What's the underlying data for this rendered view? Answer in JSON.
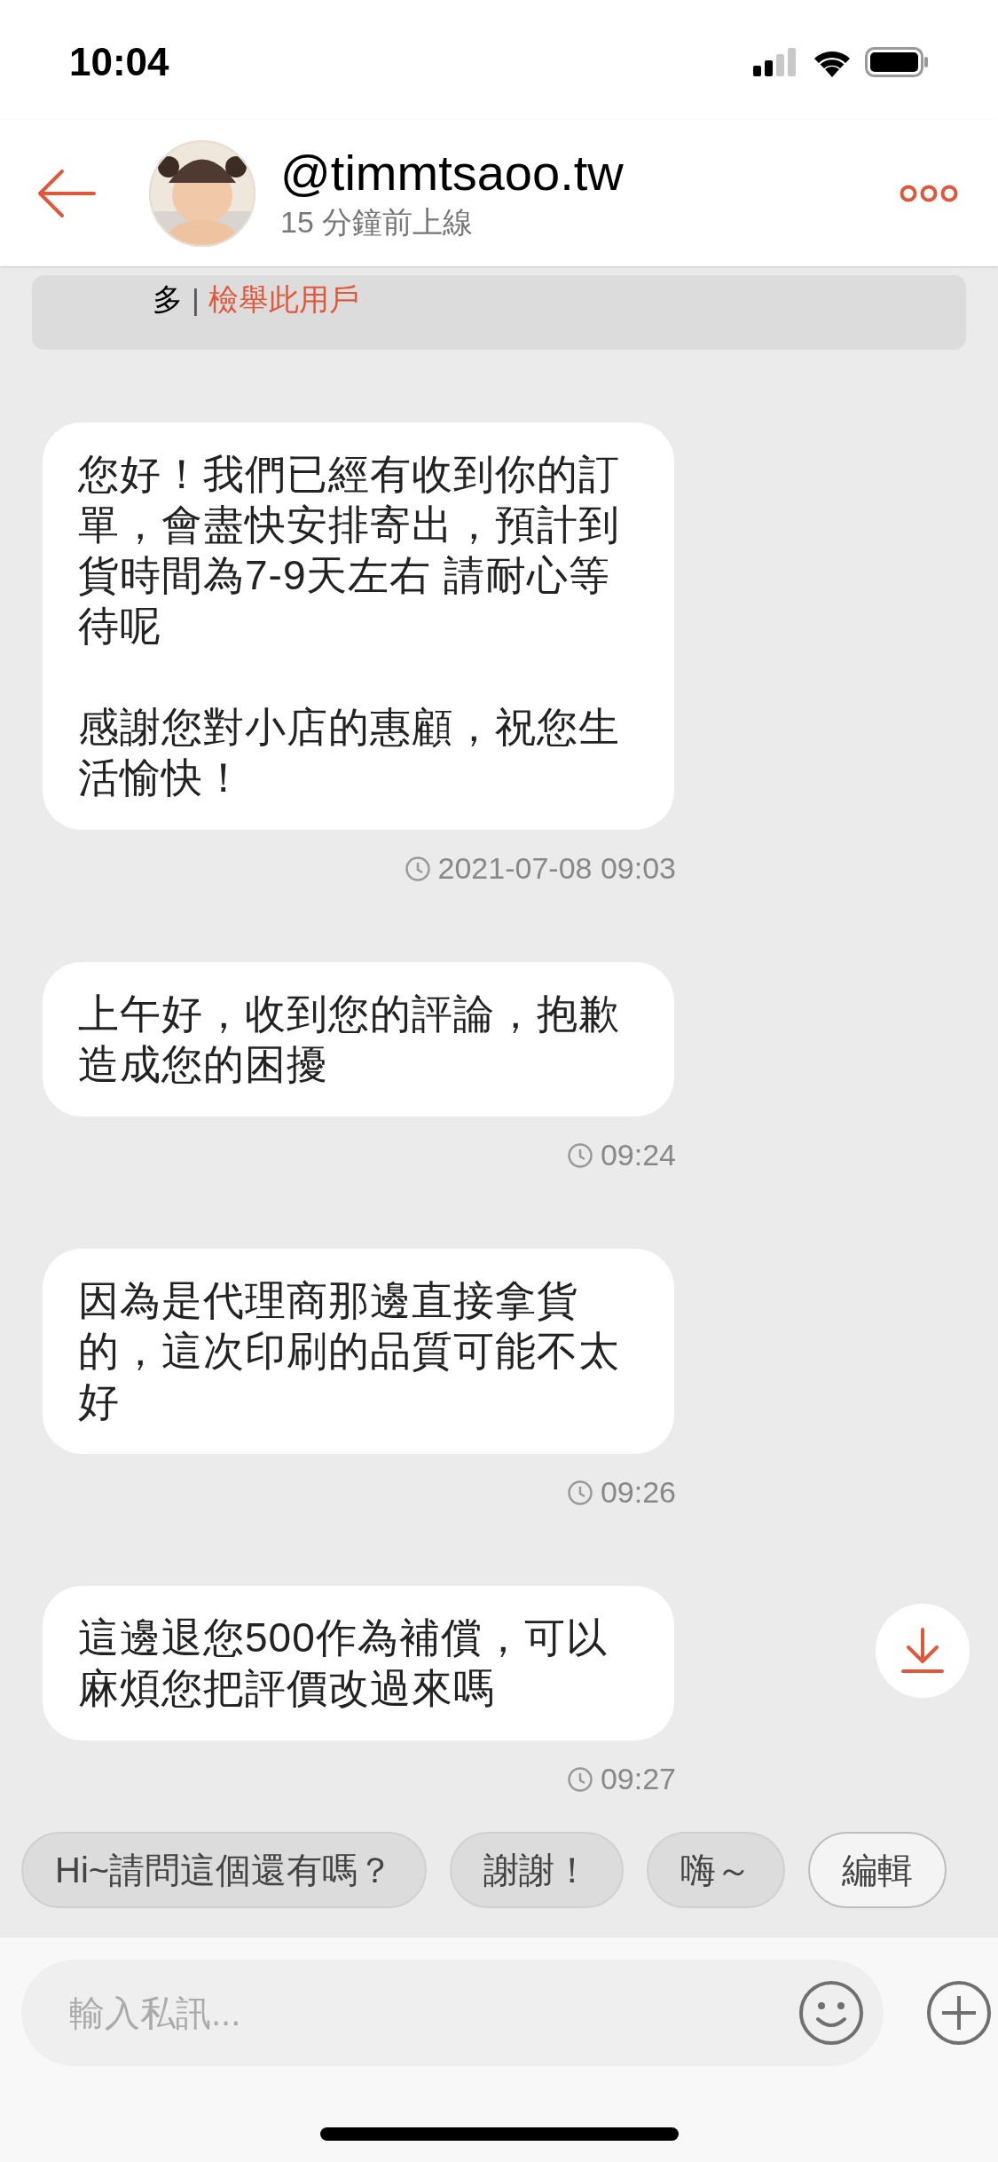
{
  "status_bar": {
    "time": "10:04"
  },
  "header": {
    "username": "@timmtsaoo.tw",
    "last_seen": "15 分鐘前上線"
  },
  "notice": {
    "learn_more": "多",
    "separator": "|",
    "report": "檢舉此用戶"
  },
  "messages": [
    {
      "paragraphs": [
        "您好！我們已經有收到你的訂單，會盡快安排寄出，預計到貨時間為7-9天左右 請耐心等待呢",
        "感謝您對小店的惠顧，祝您生活愉快！"
      ],
      "time": "2021-07-08 09:03"
    },
    {
      "paragraphs": [
        "上午好，收到您的評論，抱歉造成您的困擾"
      ],
      "time": "09:24"
    },
    {
      "paragraphs": [
        "因為是代理商那邊直接拿貨的，這次印刷的品質可能不太好"
      ],
      "time": "09:26"
    },
    {
      "paragraphs": [
        "這邊退您500作為補償，可以麻煩您把評價改過來嗎"
      ],
      "time": "09:27"
    }
  ],
  "quick_replies": [
    {
      "label": "Hi~請問這個還有嗎？",
      "kind": "reply"
    },
    {
      "label": "謝謝！",
      "kind": "reply"
    },
    {
      "label": "嗨～",
      "kind": "reply"
    },
    {
      "label": "編輯",
      "kind": "edit"
    }
  ],
  "composer": {
    "placeholder": "輸入私訊..."
  }
}
